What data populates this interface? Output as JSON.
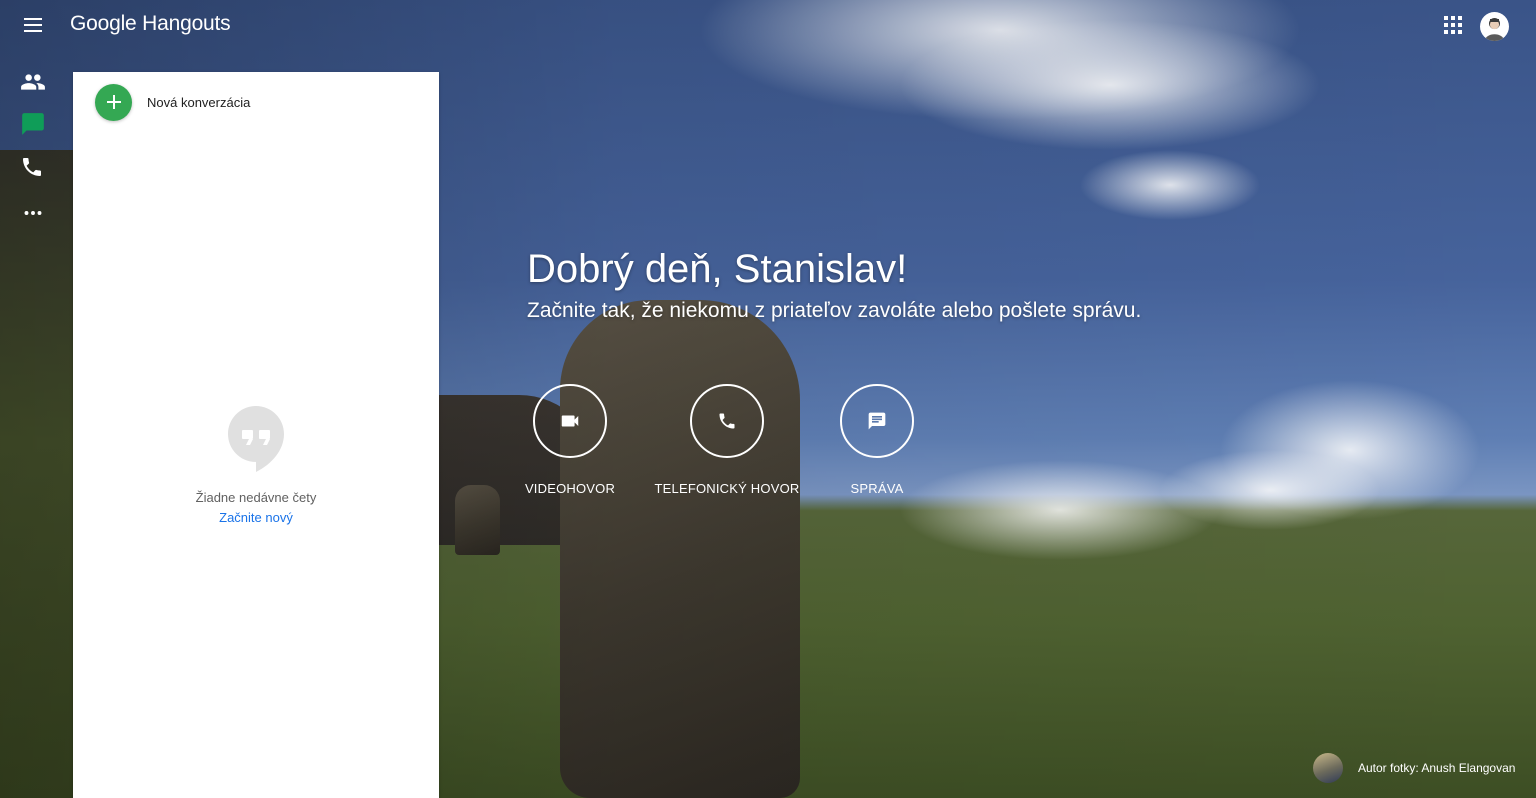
{
  "app": {
    "title_part1": "Google",
    "title_part2": "Hangouts"
  },
  "topbar": {
    "menu_icon": "hamburger-menu-icon",
    "apps_icon": "apps-grid-icon",
    "avatar": "user-avatar"
  },
  "rail": {
    "items": [
      "contacts-icon",
      "conversations-icon",
      "phone-icon",
      "more-icon"
    ],
    "active_color": "#0f9d58"
  },
  "panel": {
    "new_conversation_label": "Nová konverzácia",
    "empty_title": "Žiadne nedávne čety",
    "empty_link": "Začnite nový"
  },
  "main": {
    "greeting": "Dobrý deň, Stanislav!",
    "subtitle": "Začnite tak, že niekomu z priateľov zavoláte alebo pošlete správu.",
    "actions": [
      {
        "label": "VIDEOHOVOR",
        "icon": "videocam-icon"
      },
      {
        "label": "TELEFONICKÝ HOVOR",
        "icon": "phone-icon"
      },
      {
        "label": "SPRÁVA",
        "icon": "message-icon"
      }
    ]
  },
  "credit": {
    "text": "Autor fotky: Anush Elangovan"
  },
  "colors": {
    "accent_green": "#34a853",
    "link_blue": "#1a73e8"
  }
}
